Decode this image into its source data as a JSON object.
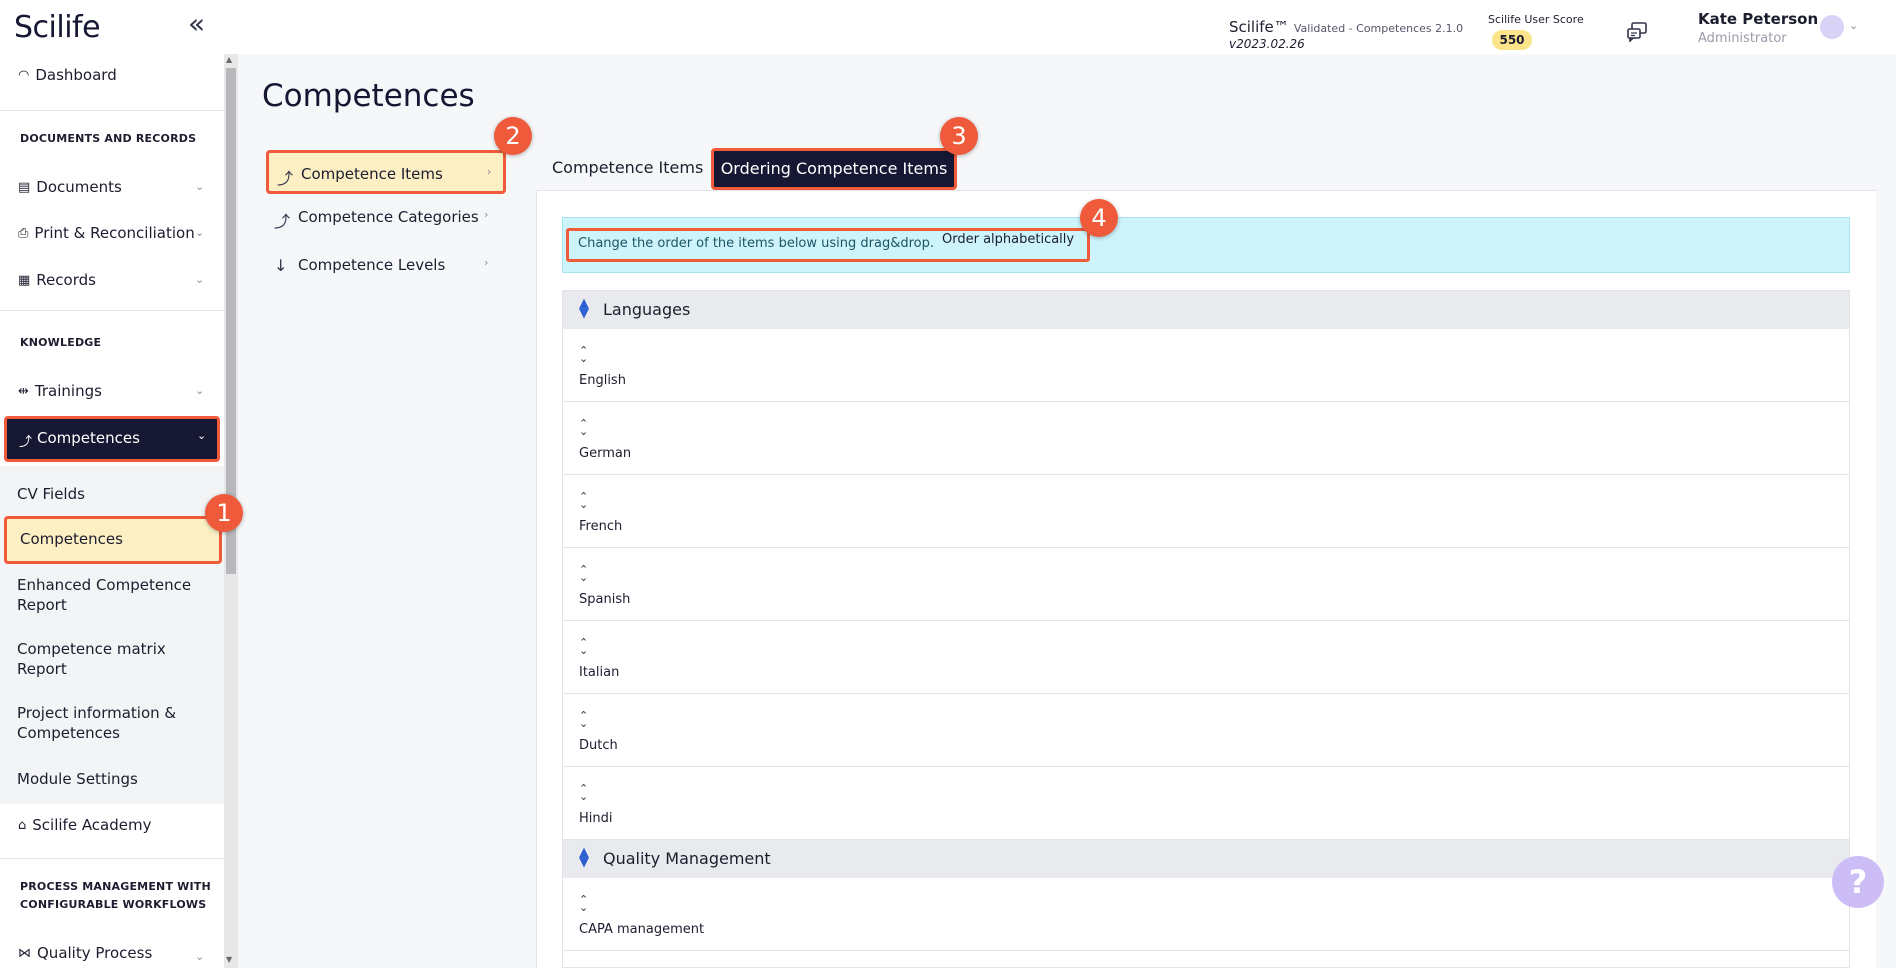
{
  "app": {
    "logo": "Scilife",
    "collapse_icon": "«",
    "product": "Scilife™",
    "validated": "Validated - Competences 2.1.0",
    "version": "v2023.02.26",
    "score_label": "Scilife User Score",
    "score_value": "550",
    "user_name": "Kate Peterson",
    "user_role": "Administrator"
  },
  "sidebar": {
    "dashboard": "Dashboard",
    "section_docs": "DOCUMENTS AND RECORDS",
    "documents": "Documents",
    "print": "Print & Reconciliation",
    "records": "Records",
    "section_knowledge": "KNOWLEDGE",
    "trainings": "Trainings",
    "competences": "Competences",
    "sub": {
      "cv_fields": "CV Fields",
      "competences": "Competences",
      "enhanced_1": "Enhanced Competence",
      "enhanced_2": "Report",
      "matrix_1": "Competence matrix",
      "matrix_2": "Report",
      "project_1": "Project information &",
      "project_2": "Competences",
      "module_settings": "Module Settings"
    },
    "academy": "Scilife Academy",
    "section_process_1": "PROCESS MANAGEMENT WITH",
    "section_process_2": "CONFIGURABLE WORKFLOWS",
    "quality_process": "Quality Process"
  },
  "main": {
    "title": "Competences",
    "secnav": [
      {
        "label": "Competence Items"
      },
      {
        "label": "Competence Categories"
      },
      {
        "label": "Competence Levels"
      }
    ],
    "tabs": [
      {
        "label": "Competence Items"
      },
      {
        "label": "Ordering Competence Items"
      }
    ],
    "info_text": "Change the order of the items below using drag&drop.",
    "order_btn": "Order alphabetically",
    "groups": [
      {
        "name": "Languages",
        "items": [
          "English",
          "German",
          "French",
          "Spanish",
          "Italian",
          "Dutch",
          "Hindi"
        ]
      },
      {
        "name": "Quality Management",
        "items": [
          "CAPA management"
        ]
      }
    ]
  },
  "callouts": [
    "1",
    "2",
    "3",
    "4"
  ],
  "help": "?",
  "colors": {
    "accent": "#ef5b3a",
    "navy": "#161833",
    "highlight": "#fdefc4",
    "info": "#cdf3fb"
  }
}
